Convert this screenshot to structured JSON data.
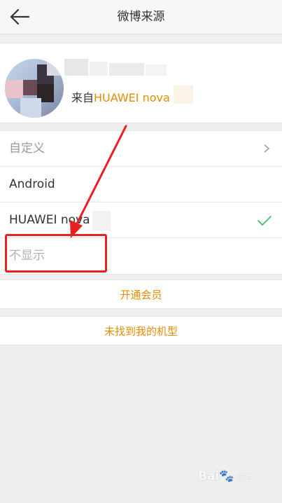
{
  "header": {
    "title": "微博来源",
    "back_icon": "arrow-left-icon"
  },
  "profile": {
    "source_prefix": "来自",
    "source_device": "HUAWEI nova"
  },
  "menu": {
    "items": [
      {
        "label": "自定义",
        "icon": "chevron-right-icon"
      },
      {
        "label": "Android"
      },
      {
        "label": "HUAWEI nova",
        "selected": true,
        "icon": "check-icon"
      },
      {
        "label": "不显示"
      }
    ]
  },
  "actions": {
    "membership": "开通会员",
    "model_not_found": "未找到我的机型"
  },
  "watermark": {
    "brand": "Bai",
    "suffix": "经验"
  },
  "colors": {
    "accent": "#ea8a00",
    "check": "#3cb371",
    "annotation": "#e8201e",
    "background": "#efefef"
  }
}
